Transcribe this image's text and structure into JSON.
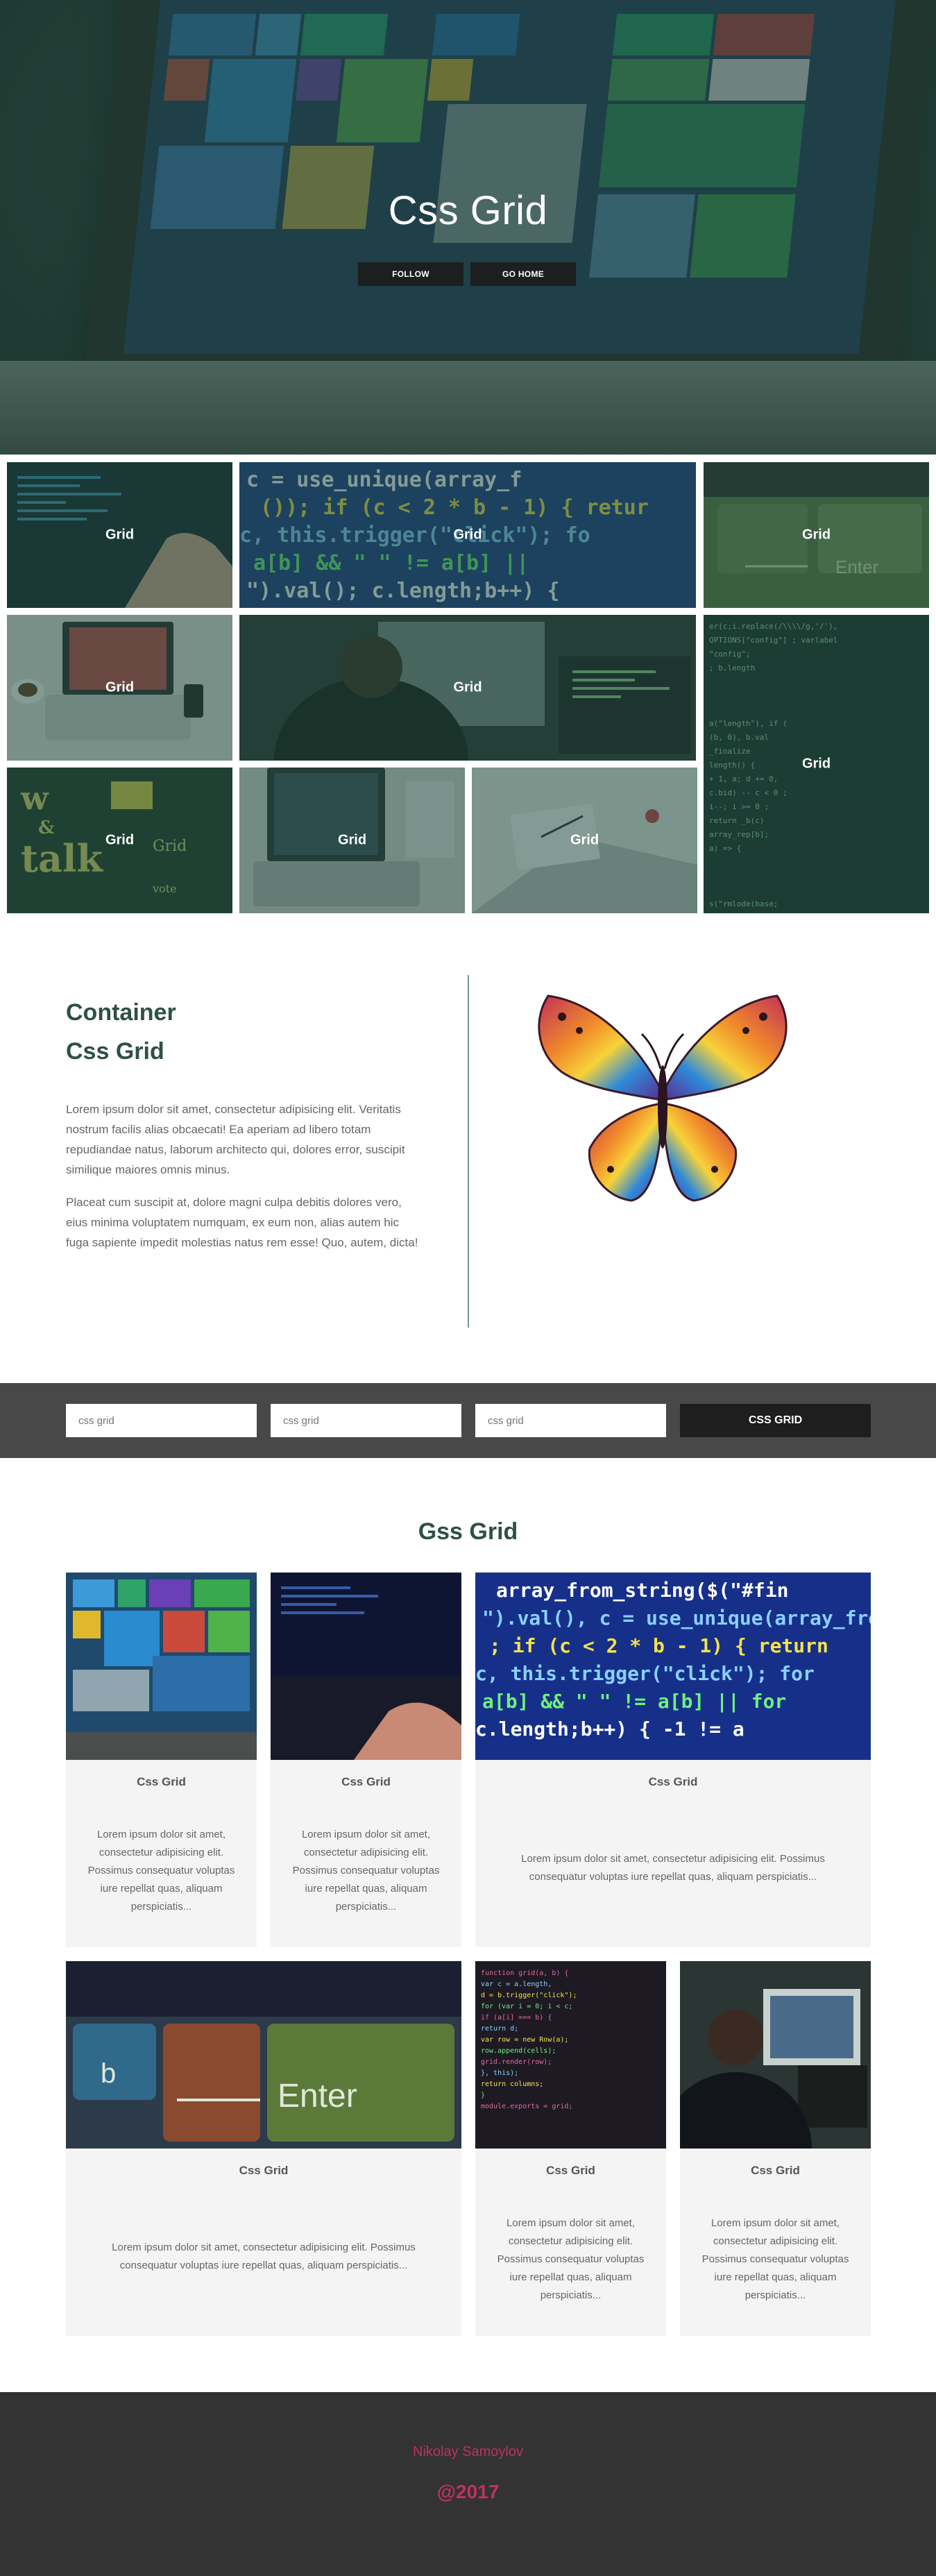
{
  "hero": {
    "title": "Css Grid",
    "follow_label": "FOLLOW",
    "go_home_label": "GO HOME",
    "overlay_color": "#23463a"
  },
  "gallery": {
    "label": "Grid",
    "items": [
      {
        "label": "Grid",
        "image": "laptop-typing-code"
      },
      {
        "label": "Grid",
        "image": "code-screen-blue"
      },
      {
        "label": "Grid",
        "image": "keyboard-enter"
      },
      {
        "label": "Grid",
        "image": "laptop-coffee"
      },
      {
        "label": "Grid",
        "image": "man-at-monitors"
      },
      {
        "label": "Grid",
        "image": "code-screen-tall"
      },
      {
        "label": "Grid",
        "image": "talk-chalkboard"
      },
      {
        "label": "Grid",
        "image": "laptop-desk"
      },
      {
        "label": "Grid",
        "image": "drawing-laptop"
      }
    ]
  },
  "container": {
    "title_line1": "Container",
    "title_line2": "Css Grid",
    "paragraph1": "Lorem ipsum dolor sit amet, consectetur adipisicing elit. Veritatis nostrum facilis alias obcaecati! Ea aperiam ad libero totam repudiandae natus, laborum architecto qui, dolores error, suscipit similique maiores omnis minus.",
    "paragraph2": "Placeat cum suscipit at, dolore magni culpa debitis dolores vero, eius minima voluptatem numquam, ex eum non, alias autem hic fuga sapiente impedit molestias natus rem esse! Quo, autem, dicta!",
    "image": "butterfly"
  },
  "form": {
    "input1_placeholder": "css grid",
    "input2_placeholder": "css grid",
    "input3_placeholder": "css grid",
    "button_label": "CSS GRID"
  },
  "cards_section": {
    "title": "Gss Grid",
    "cards": [
      {
        "title": "Css Grid",
        "text": "Lorem ipsum dolor sit amet, consectetur adipisicing elit. Possimus consequatur voluptas iure repellat quas, aliquam perspiciatis...",
        "image": "laptop-tiles"
      },
      {
        "title": "Css Grid",
        "text": "Lorem ipsum dolor sit amet, consectetur adipisicing elit. Possimus consequatur voluptas iure repellat quas, aliquam perspiciatis...",
        "image": "hands-keyboard"
      },
      {
        "title": "Css Grid",
        "text": "Lorem ipsum dolor sit amet, consectetur adipisicing elit. Possimus consequatur voluptas iure repellat quas, aliquam perspiciatis...",
        "image": "code-screen-blue"
      },
      {
        "title": "Css Grid",
        "text": "Lorem ipsum dolor sit amet, consectetur adipisicing elit. Possimus consequatur voluptas iure repellat quas, aliquam perspiciatis...",
        "image": "keyboard-enter"
      },
      {
        "title": "Css Grid",
        "text": "Lorem ipsum dolor sit amet, consectetur adipisicing elit. Possimus consequatur voluptas iure repellat quas, aliquam perspiciatis...",
        "image": "code-dark"
      },
      {
        "title": "Css Grid",
        "text": "Lorem ipsum dolor sit amet, consectetur adipisicing elit. Possimus consequatur voluptas iure repellat quas, aliquam perspiciatis...",
        "image": "man-at-monitors"
      }
    ]
  },
  "footer": {
    "name": "Nikolay Samoylov",
    "year": "@2017",
    "accent_color": "#c0325d"
  }
}
